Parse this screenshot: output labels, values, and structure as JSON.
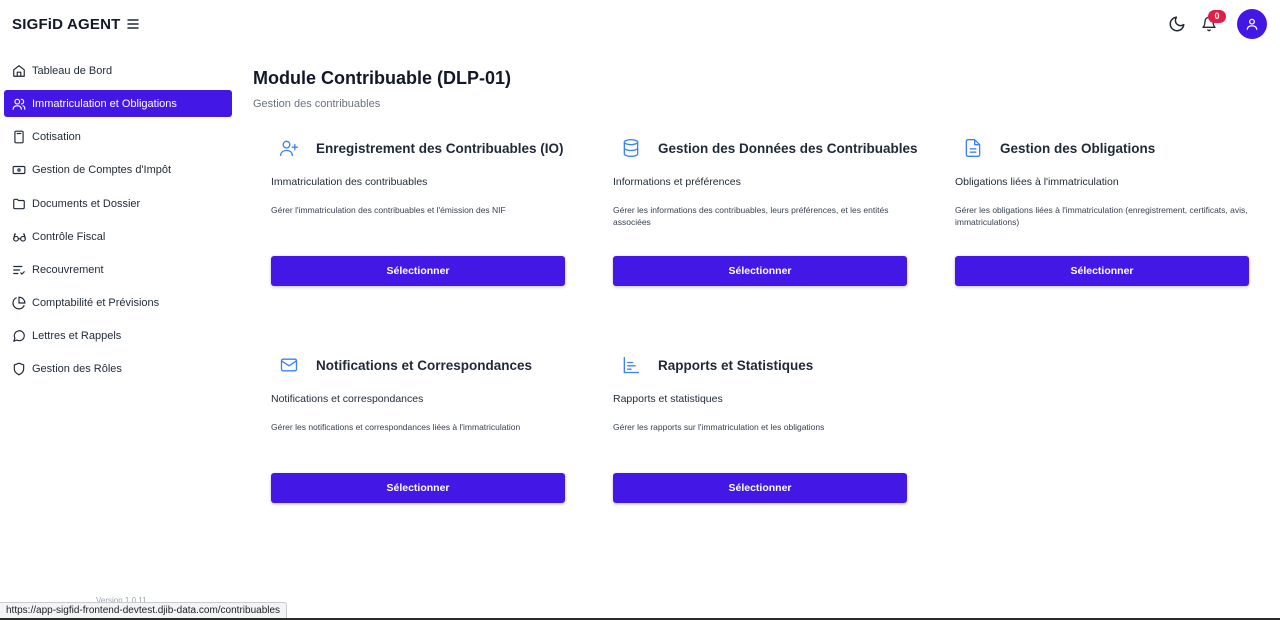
{
  "app": {
    "brand": "SIGFiD AGENT",
    "version": "Version 1.0.11"
  },
  "header": {
    "notification_count": "0",
    "accent_color": "#4318e6",
    "badge_color": "#e11d48"
  },
  "sidebar": {
    "items": [
      {
        "label": "Tableau de Bord",
        "icon": "home-icon"
      },
      {
        "label": "Immatriculation et Obligations",
        "icon": "users-icon",
        "active": true
      },
      {
        "label": "Cotisation",
        "icon": "calculator-icon"
      },
      {
        "label": "Gestion de Comptes d'Impôt",
        "icon": "banknote-icon"
      },
      {
        "label": "Documents et Dossier",
        "icon": "folder-icon"
      },
      {
        "label": "Contrôle Fiscal",
        "icon": "glasses-icon"
      },
      {
        "label": "Recouvrement",
        "icon": "list-check-icon"
      },
      {
        "label": "Comptabilité et Prévisions",
        "icon": "pie-chart-icon"
      },
      {
        "label": "Lettres et Rappels",
        "icon": "message-circle-icon"
      },
      {
        "label": "Gestion des Rôles",
        "icon": "shield-icon"
      }
    ]
  },
  "main": {
    "title": "Module Contribuable (DLP-01)",
    "subtitle": "Gestion des contribuables",
    "cards": [
      {
        "title": "Enregistrement des Contribuables (IO)",
        "subtitle": "Immatriculation des contribuables",
        "description": "Gérer l'immatriculation des contribuables et l'émission des NIF",
        "button": "Sélectionner",
        "icon": "user-plus-icon"
      },
      {
        "title": "Gestion des Données des Contribuables",
        "subtitle": "Informations et préférences",
        "description": "Gérer les informations des contribuables, leurs préférences, et les entités associées",
        "button": "Sélectionner",
        "icon": "database-icon"
      },
      {
        "title": "Gestion des Obligations",
        "subtitle": "Obligations liées à l'immatriculation",
        "description": "Gérer les obligations liées à l'immatriculation (enregistrement, certificats, avis, immatriculations)",
        "button": "Sélectionner",
        "icon": "file-text-icon"
      },
      {
        "title": "Notifications et Correspondances",
        "subtitle": "Notifications et correspondances",
        "description": "Gérer les notifications et correspondances liées à l'immatriculation",
        "button": "Sélectionner",
        "icon": "mail-icon"
      },
      {
        "title": "Rapports et Statistiques",
        "subtitle": "Rapports et statistiques",
        "description": "Gérer les rapports sur l'immatriculation et les obligations",
        "button": "Sélectionner",
        "icon": "bar-chart-icon"
      }
    ]
  },
  "browser": {
    "status_url": "https://app-sigfid-frontend-devtest.djib-data.com/contribuables"
  }
}
